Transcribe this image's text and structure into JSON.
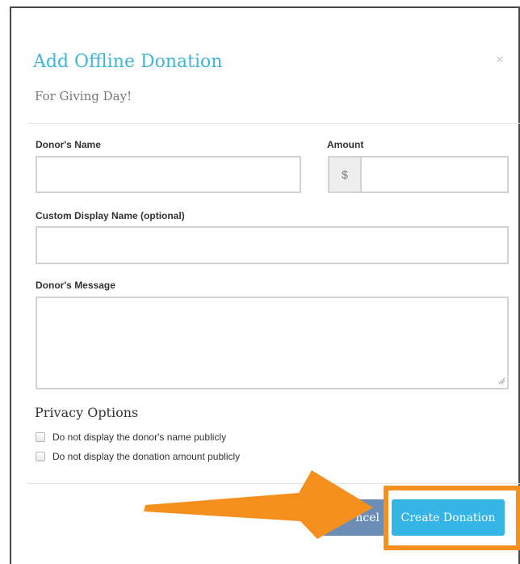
{
  "dialog": {
    "title": "Add Offline Donation",
    "subtitle": "For Giving Day!",
    "close_glyph": "×"
  },
  "form": {
    "donor_name": {
      "label": "Donor's Name",
      "value": "",
      "placeholder": ""
    },
    "amount": {
      "label": "Amount",
      "currency_symbol": "$",
      "value": "",
      "placeholder": ""
    },
    "display_name": {
      "label": "Custom Display Name (optional)",
      "value": "",
      "placeholder": ""
    },
    "message": {
      "label": "Donor's Message",
      "value": "",
      "placeholder": ""
    }
  },
  "privacy": {
    "heading": "Privacy Options",
    "options": [
      {
        "label": "Do not display the donor's name publicly",
        "checked": false
      },
      {
        "label": "Do not display the donation amount publicly",
        "checked": false
      }
    ]
  },
  "footer": {
    "cancel_label": "ncel",
    "create_label": "Create Donation"
  },
  "annotation": {
    "arrow_color": "#f5901e",
    "highlight_color": "#f5901e"
  },
  "colors": {
    "accent": "#3fb6d9",
    "primary_button": "#35b5e5",
    "cancel_button": "#6c8db6"
  }
}
